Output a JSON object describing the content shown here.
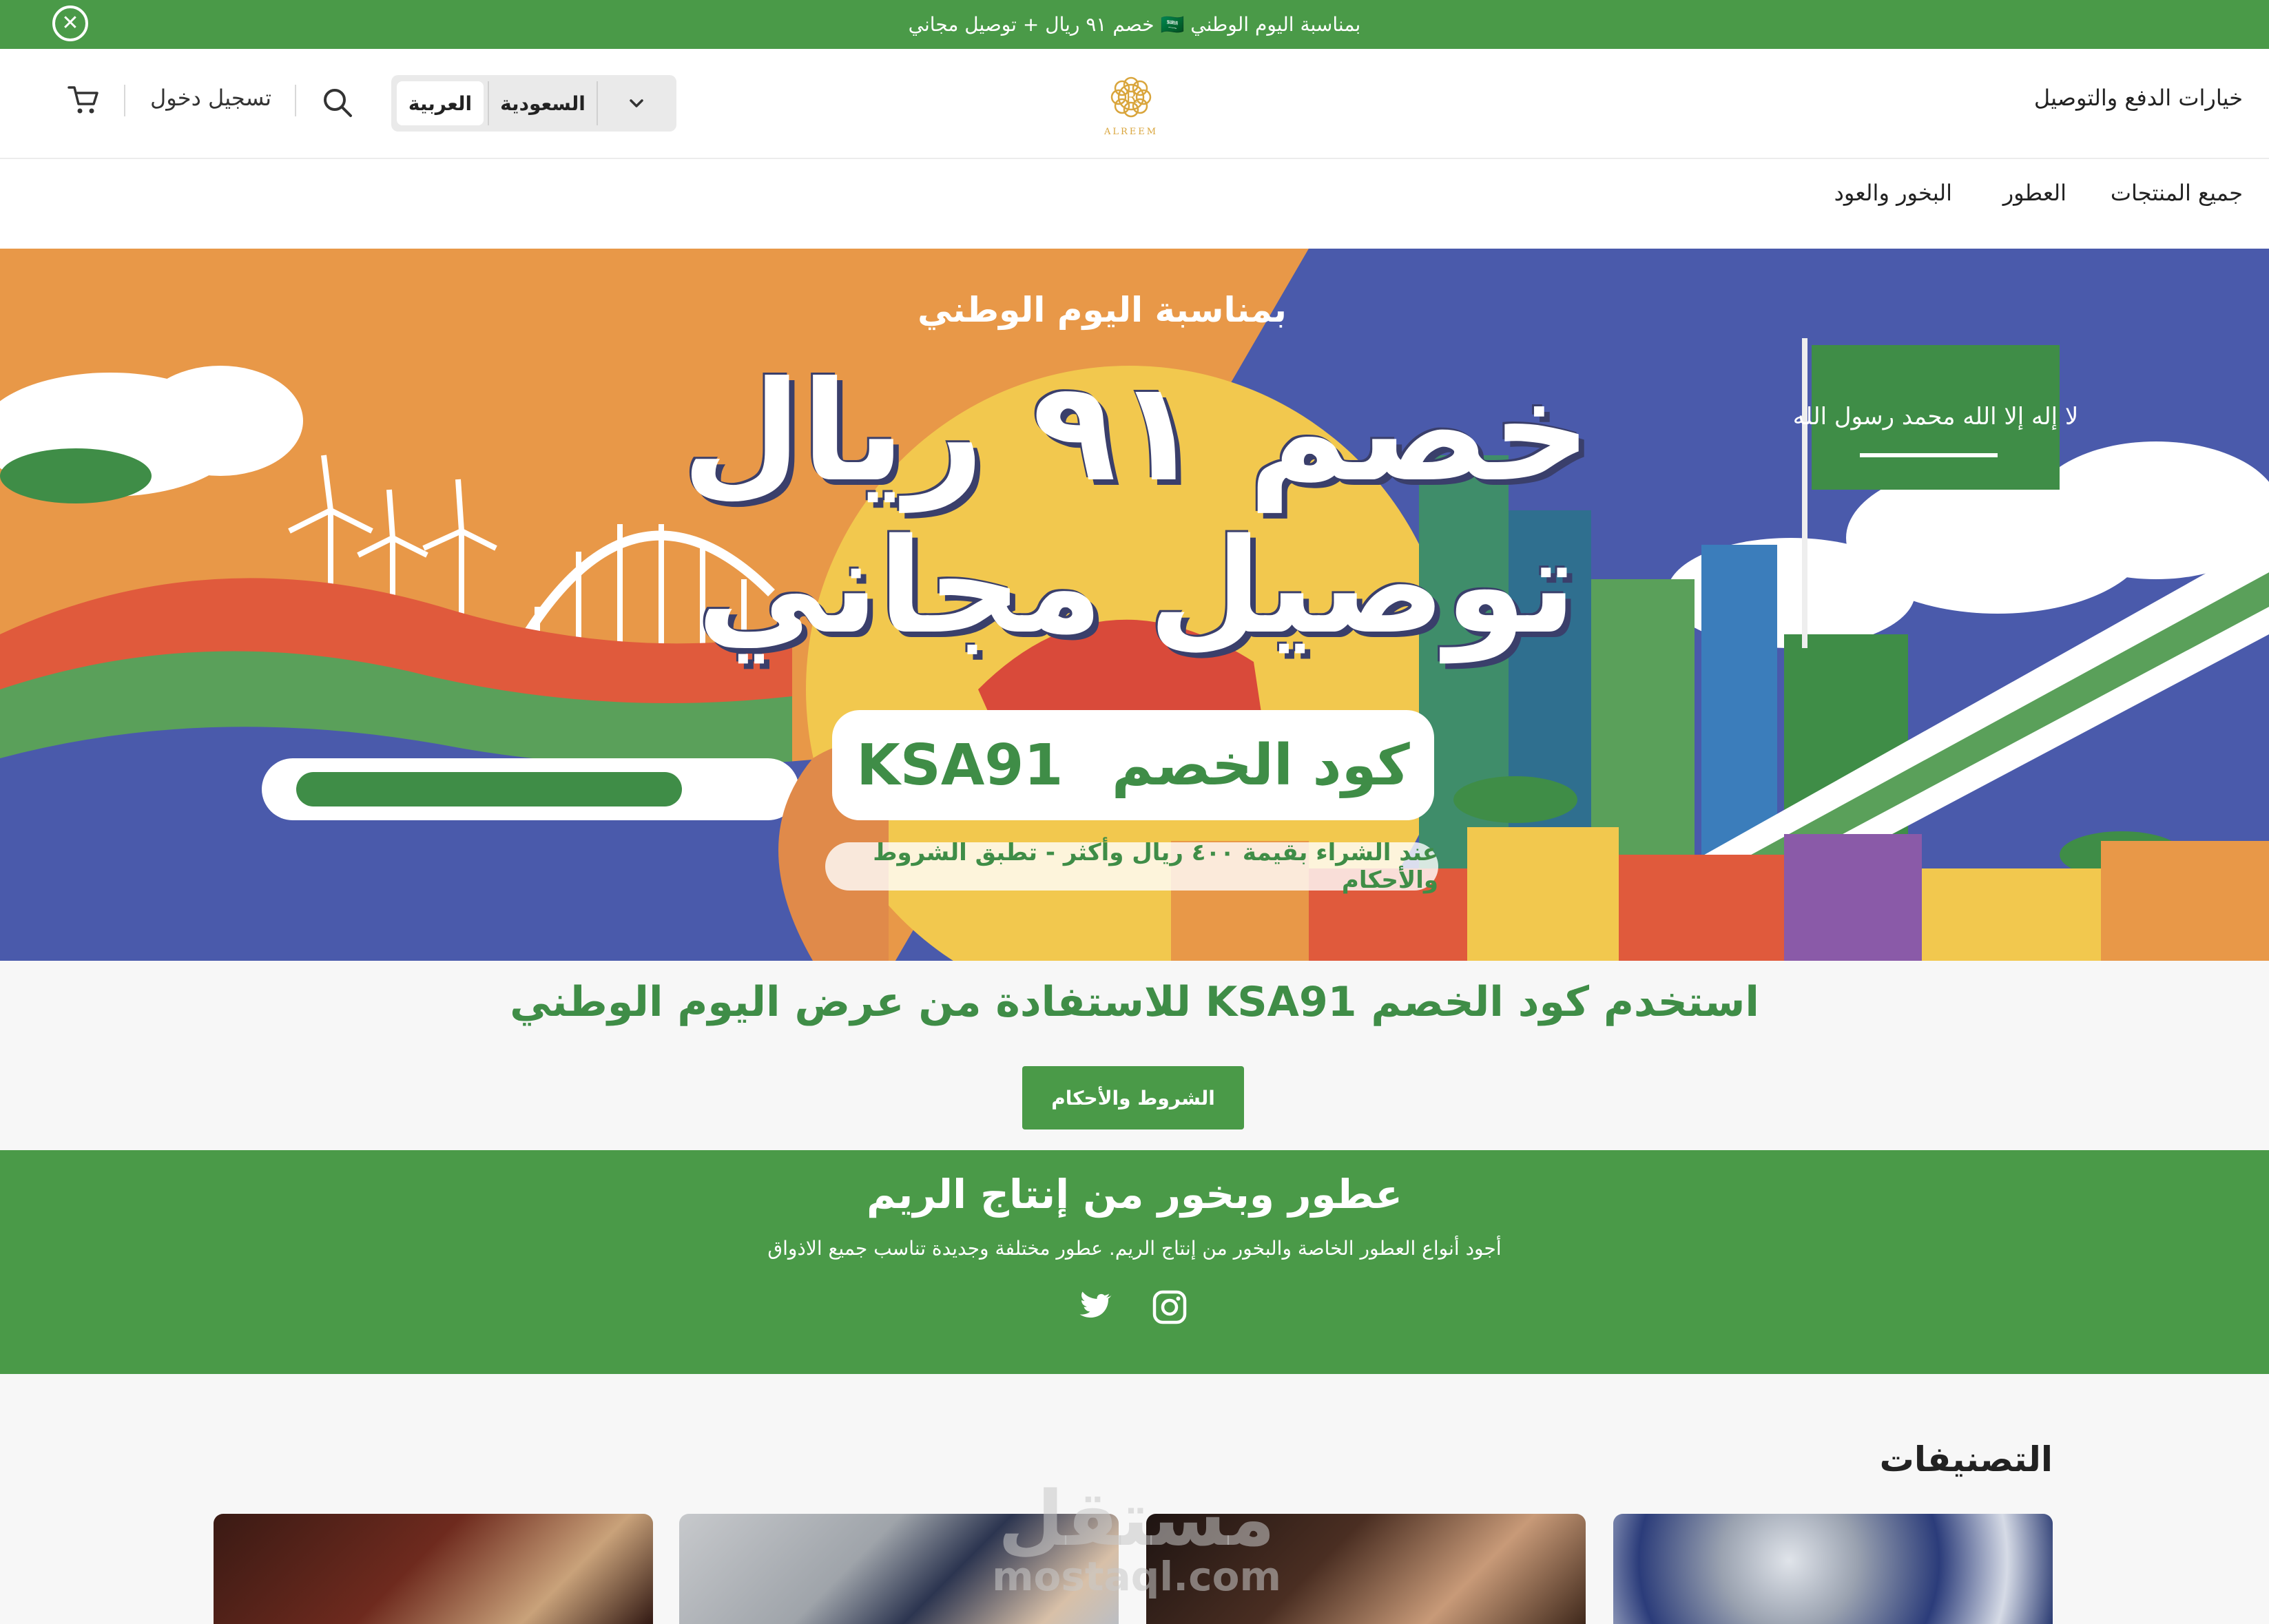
{
  "announcement": {
    "text": "بمناسبة اليوم الوطني 🇸🇦 خصم ٩١ ريال + توصيل مجاني",
    "close_icon": "close-circle-icon"
  },
  "header": {
    "payment_link": "خيارات الدفع والتوصيل",
    "language": "العربية",
    "country": "السعودية",
    "login": "تسجيل دخول",
    "icons": {
      "cart": "cart-icon",
      "search": "search-icon",
      "chevron": "chevron-down-icon"
    },
    "logo_text": "ALREEM"
  },
  "nav": {
    "items": [
      {
        "label": "جميع المنتجات"
      },
      {
        "label": "العطور"
      },
      {
        "label": "البخور والعود"
      }
    ]
  },
  "hero": {
    "subtitle": "بمناسبة اليوم الوطني",
    "title_line1": "خصم ٩١ ريال",
    "title_line2": "توصيل مجاني",
    "code_label": "كود الخصم",
    "code_value": "KSA91",
    "terms_note": "عند الشراء بقيمة ٤٠٠ ريال وأكثر - تطبق الشروط والأحكام",
    "flag_text": "لا إله إلا الله محمد رسول الله"
  },
  "promo": {
    "heading": "استخدم كود الخصم KSA91 للاستفادة من عرض اليوم الوطني",
    "button": "الشروط والأحكام"
  },
  "brand": {
    "title": "عطور وبخور من إنتاج الريم",
    "description": "أجود أنواع العطور الخاصة والبخور من إنتاج الريم. عطور مختلفة وجديدة تناسب جميع الاذواق",
    "social": [
      "instagram-icon",
      "twitter-icon"
    ]
  },
  "categories": {
    "heading": "التصنيفات"
  },
  "watermark": {
    "line1": "مستقل",
    "line2": "mostaql.com"
  },
  "colors": {
    "brand_green": "#4a9a48",
    "text_green": "#3f8d47",
    "gold": "#d9a53c"
  }
}
